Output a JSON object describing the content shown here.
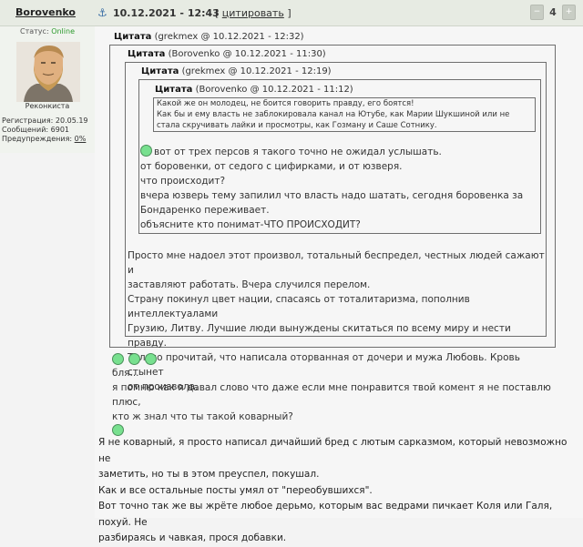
{
  "header": {
    "author": "Borovenko",
    "date": "10.12.2021 - 12:43",
    "cite_open": "[ ",
    "cite_label": "цитировать",
    "cite_close": " ]",
    "rating_count": "4"
  },
  "profile": {
    "status_label": "Статус:",
    "status_value": "Online",
    "rank": "Реконкиста",
    "registration": "Регистрация: 20.05.19",
    "messages": "Сообщений: 6901",
    "warnings_label": "Предупреждения:",
    "warnings_value": "0%"
  },
  "quotes": {
    "q1_label": "Цитата",
    "q1_meta": "(grekmex @ 10.12.2021 - 12:32)",
    "q2_label": "Цитата",
    "q2_meta": "(Borovenko @ 10.12.2021 - 11:30)",
    "q3_label": "Цитата",
    "q3_meta": "(grekmex @ 10.12.2021 - 12:19)",
    "q4_label": "Цитата",
    "q4_meta": "(Borovenko @ 10.12.2021 - 11:12)",
    "q4_lines": [
      "Какой же он молодец, не боится говорить правду, его боятся!",
      "Как бы и ему власть не заблокировала канал на Ютубе, как Марии Шукшиной или не",
      "стала скручивать лайки и просмотры, как Гозману и Саше Сотнику."
    ],
    "q3_lines": [
      "вот от трех персов я такого точно не ожидал услышать.",
      "от боровенки, от седого с цифирками, и от юзверя.",
      "что происходит?",
      "вчера юзверь тему запилил что власть надо шатать, сегодня боровенка за",
      "Бондаренко переживает.",
      "объясните кто понимат-ЧТО ПРОИСХОДИТ?"
    ],
    "q2_lines": [
      "Просто мне надоел этот произвол, тотальный беспредел, честных людей сажают и",
      "заставляют работать. Вчера случился перелом.",
      "Страну покинул цвет нации, спасаясь от тоталитаризма, пополнив интеллектуалами",
      "Грузию, Литву. Лучшие люди вынуждены скитаться по всему миру и нести правду.",
      "Только прочитай, что написала оторванная от дочери и мужа Любовь. Кровь стынет",
      "от произвола."
    ],
    "q1_lines": [
      "бля...",
      "я помню как я давал слово что даже если мне понравится твой комент я не поставлю плюс,",
      "кто ж знал что ты такой коварный?"
    ]
  },
  "post_lines": [
    "Я не коварный, я просто написал дичайший бред с лютым сарказмом, который невозможно не",
    "заметить, но ты в этом преуспел, покушал.",
    "Как и все остальные посты умял от \"переобувшихся\".",
    "Вот точно так же вы жрёте любое дерьмо, которым вас ведрами пичкает Коля или Галя, похуй. Не",
    "разбираясь и чавкая, прося добавки."
  ],
  "colors": {
    "header_bg": "#e7ebe3",
    "online": "#2e9b2e",
    "emoji": "#78e08f"
  }
}
